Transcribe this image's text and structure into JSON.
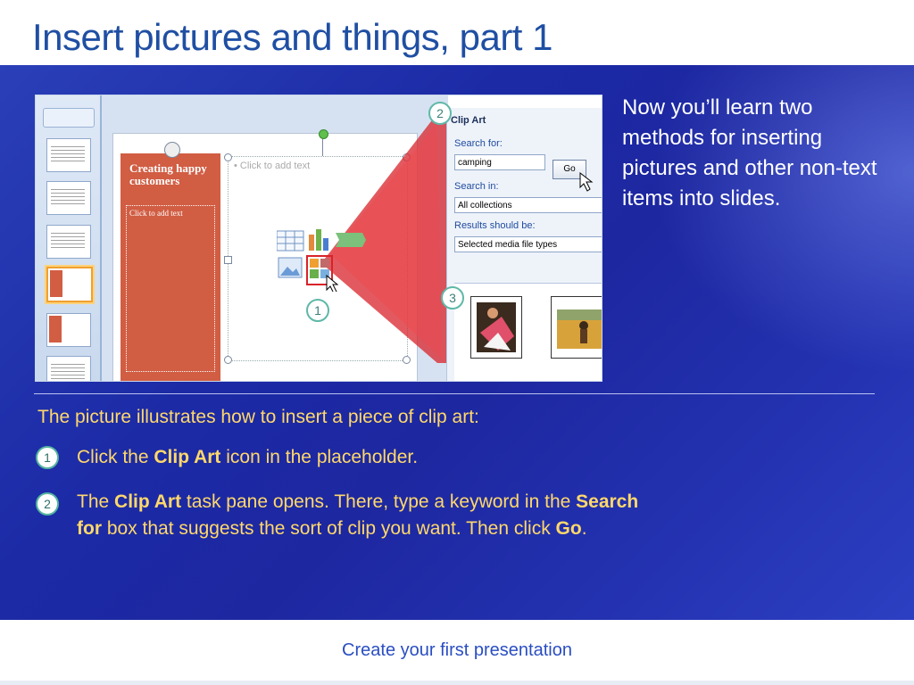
{
  "title": "Insert pictures and things, part 1",
  "intro": "Now you’ll learn two methods for inserting pictures and other non-text items into slides.",
  "lead": "The picture illustrates how to insert a piece of clip art:",
  "steps": [
    {
      "number": "1",
      "parts": [
        "Click the ",
        "Clip Art",
        " icon in the placeholder."
      ]
    },
    {
      "number": "2",
      "parts": [
        "The ",
        "Clip Art",
        " task pane opens. There, type a keyword in the ",
        "Search for",
        " box that suggests the sort of clip you want. Then click ",
        "Go",
        "."
      ]
    }
  ],
  "footer": "Create your first presentation",
  "screenshot": {
    "slide_title": "Creating happy customers",
    "slide_subtitle": "Click to add text",
    "placeholder_text": "• Click to add text",
    "pane_title": "Clip Art",
    "search_for_label": "Search for:",
    "search_for_value": "camping",
    "go_label": "Go",
    "search_in_label": "Search in:",
    "search_in_value": "All collections",
    "results_label": "Results should be:",
    "results_value": "Selected media file types",
    "callouts": [
      "1",
      "2",
      "3"
    ]
  },
  "colors": {
    "title": "#1f4fa3",
    "band": "#1d27a0",
    "step_text": "#ffd86b",
    "accent_red": "#d15d43"
  }
}
